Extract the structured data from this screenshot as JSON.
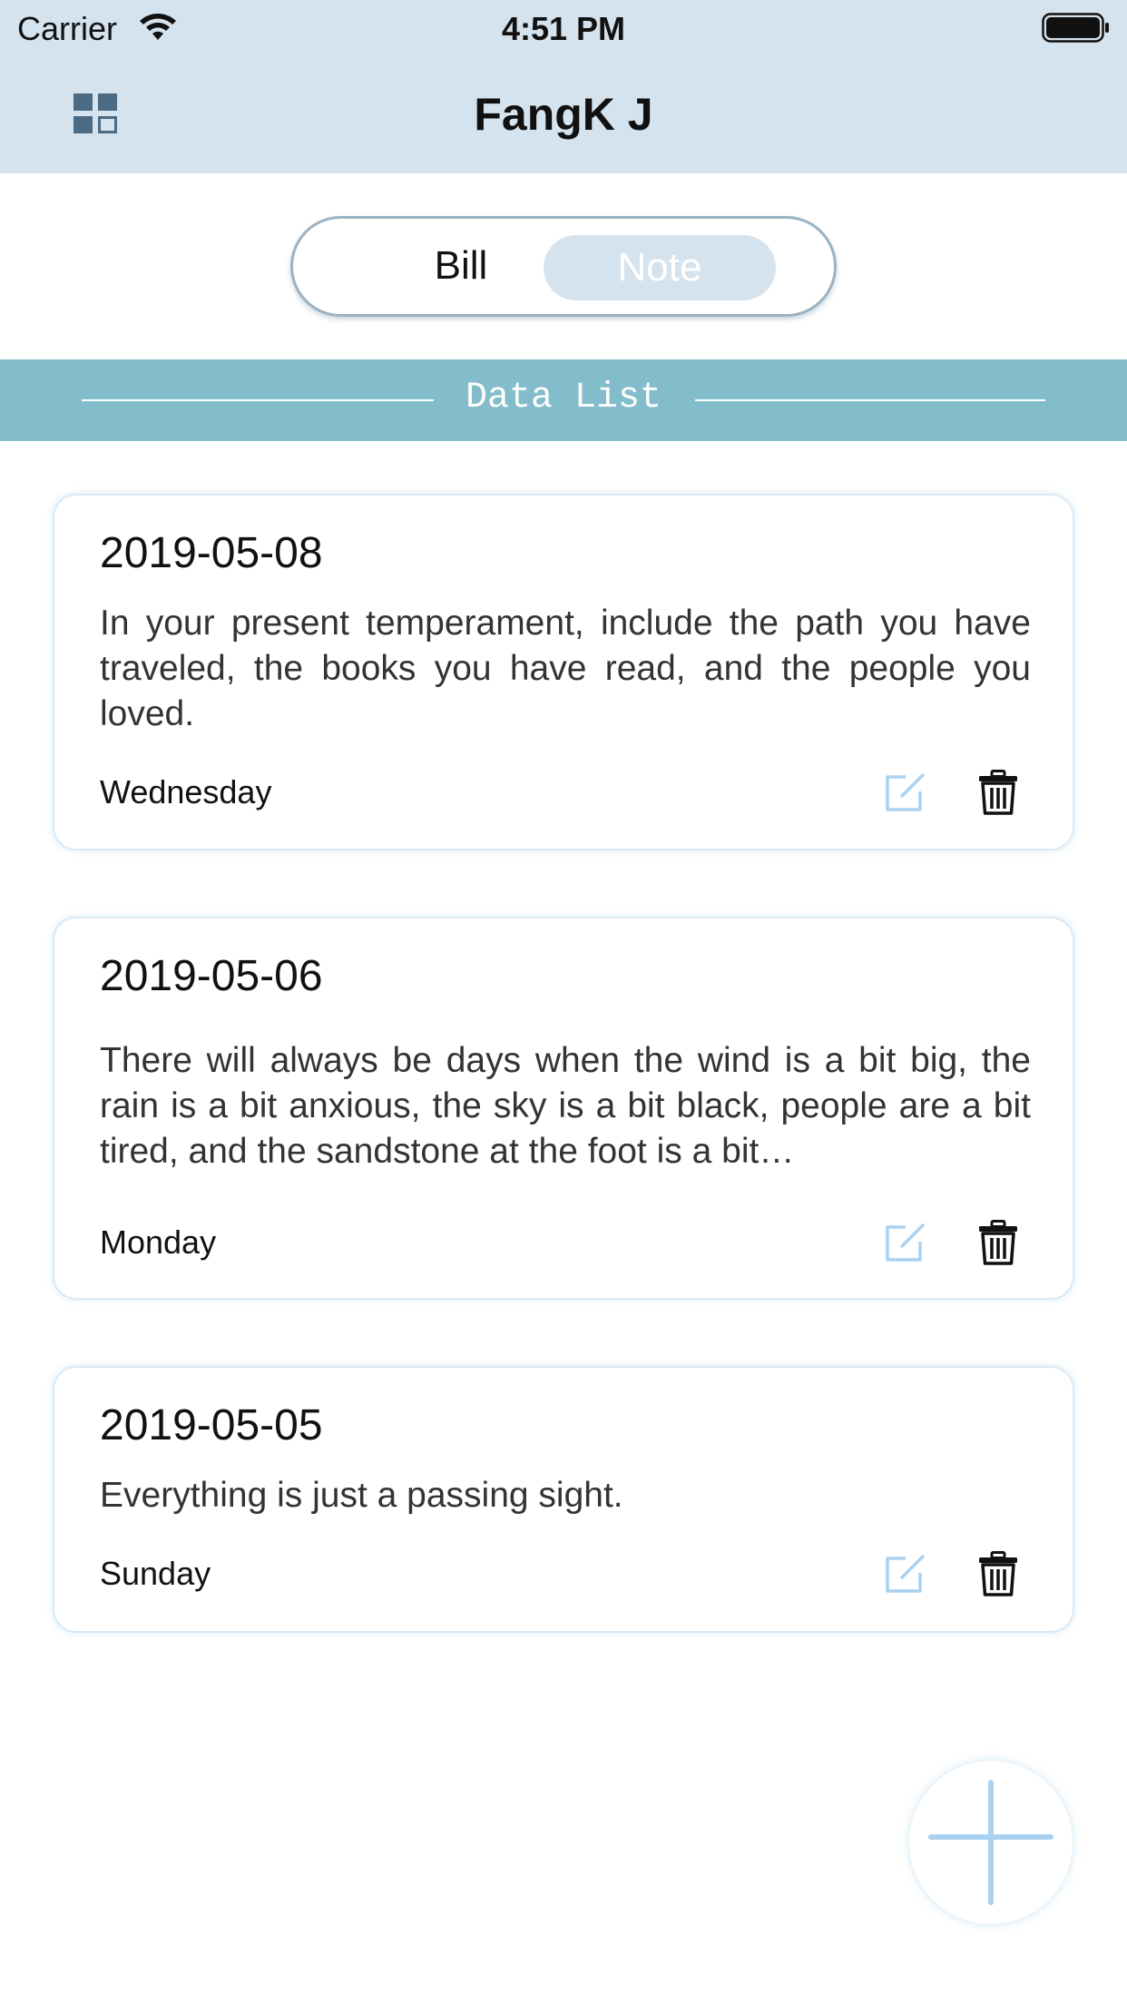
{
  "status_bar": {
    "carrier": "Carrier",
    "time": "4:51 PM"
  },
  "nav": {
    "title": "FangK J",
    "menu_icon": "grid-icon"
  },
  "segment": {
    "options": [
      "Bill",
      "Note"
    ],
    "selected": "Note"
  },
  "section": {
    "title": "Data List"
  },
  "notes": [
    {
      "date": "2019-05-08",
      "text": "In your present temperament,  include the path you have traveled, the books you have read, and the people you loved.",
      "day": "Wednesday"
    },
    {
      "date": "2019-05-06",
      "text": "There will always be days when the wind is a bit big, the rain is a bit anxious, the sky is a bit black, people are a bit tired, and the sandstone at the foot is a bit…",
      "day": "Monday"
    },
    {
      "date": "2019-05-05",
      "text": "Everything is just a passing sight.",
      "day": "Sunday"
    }
  ],
  "icons": {
    "edit": "edit-icon",
    "delete": "trash-icon",
    "add": "plus-icon"
  },
  "colors": {
    "nav_bg": "#d5e3ee",
    "section_bg": "#83bcca",
    "accent": "#a9d2f2"
  }
}
